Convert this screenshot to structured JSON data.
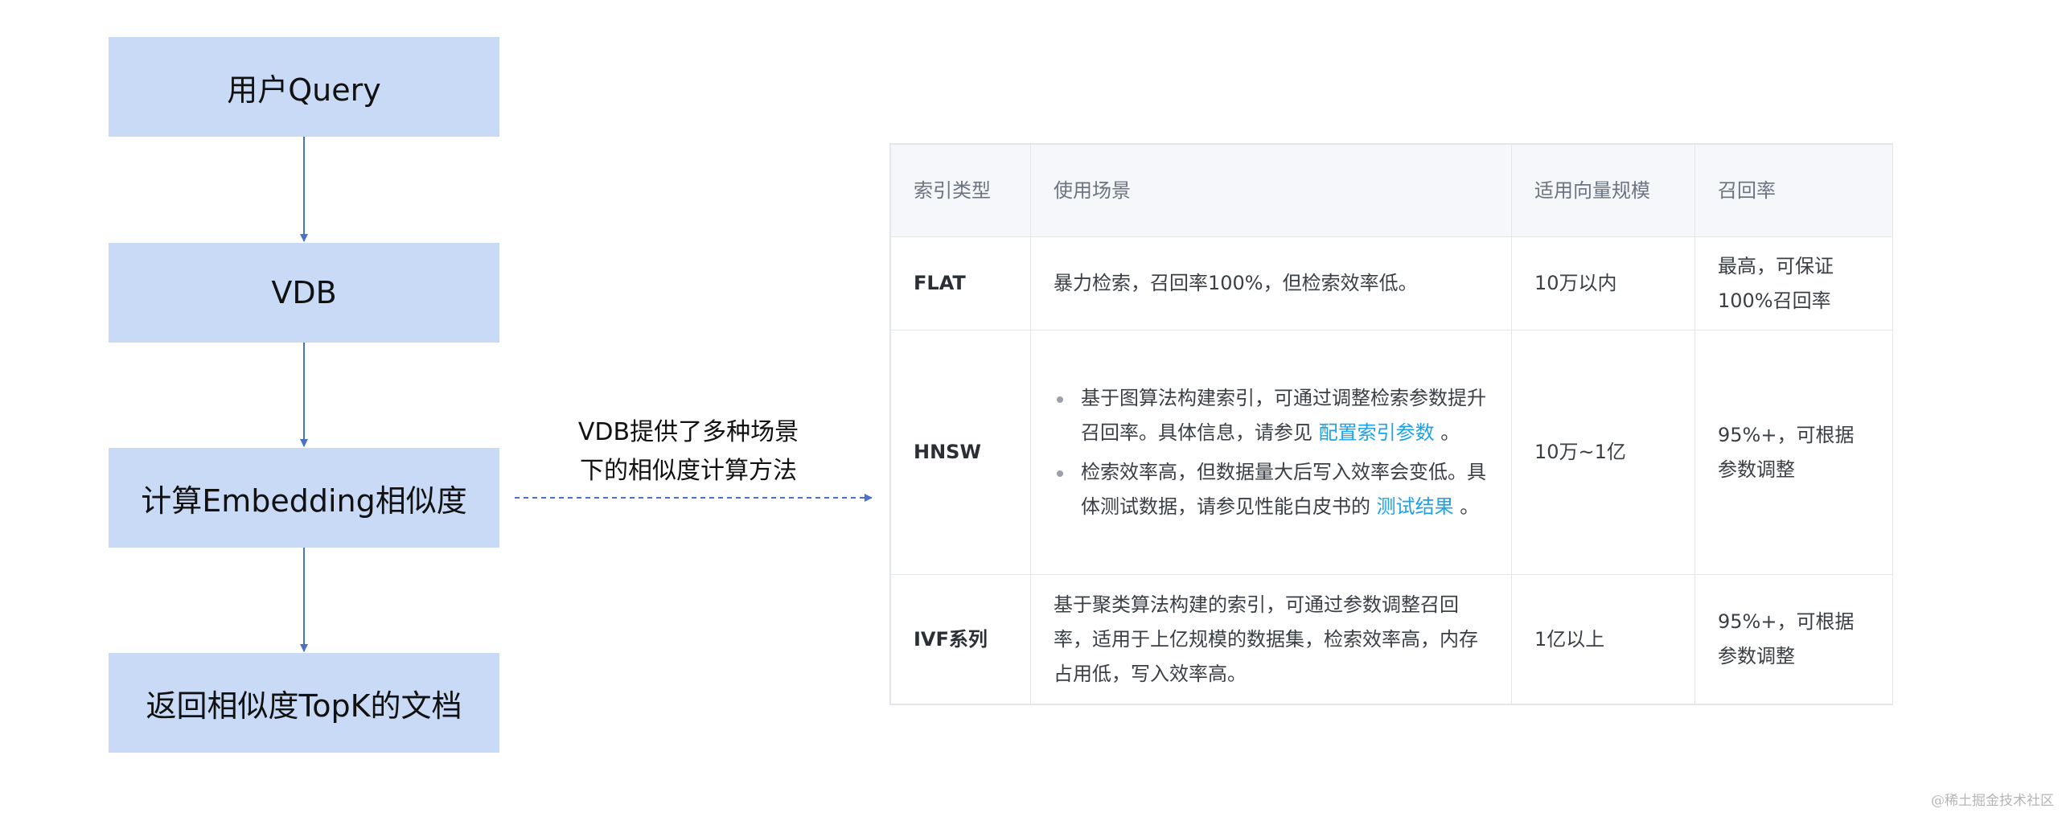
{
  "flow": {
    "steps": [
      "用户Query",
      "VDB",
      "计算Embedding相似度",
      "返回相似度TopK的文档"
    ],
    "annotation_line1": "VDB提供了多种场景",
    "annotation_line2": "下的相似度计算方法"
  },
  "table": {
    "headers": [
      "索引类型",
      "使用场景",
      "适用向量规模",
      "召回率"
    ],
    "rows": [
      {
        "type": "FLAT",
        "scenario": "暴力检索，召回率100%，但检索效率低。",
        "scale": "10万以内",
        "recall": "最高，可保证100%召回率"
      },
      {
        "type": "HNSW",
        "bullet1_text": "基于图算法构建索引，可通过调整检索参数提升召回率。具体信息，请参见",
        "bullet1_link": "配置索引参数",
        "bullet1_end": "。",
        "bullet2_text": "检索效率高，但数据量大后写入效率会变低。具体测试数据，请参见性能白皮书的",
        "bullet2_link": "测试结果",
        "bullet2_end": "。",
        "scale": "10万~1亿",
        "recall": "95%+，可根据参数调整"
      },
      {
        "type": "IVF系列",
        "scenario": "基于聚类算法构建的索引，可通过参数调整召回率，适用于上亿规模的数据集，检索效率高，内存占用低，写入效率高。",
        "scale": "1亿以上",
        "recall": "95%+，可根据参数调整"
      }
    ]
  },
  "watermark": "@稀土掘金技术社区",
  "colors": {
    "box_fill": "#c9daf6",
    "arrow": "#4a72c4",
    "link": "#1aa3e8"
  }
}
